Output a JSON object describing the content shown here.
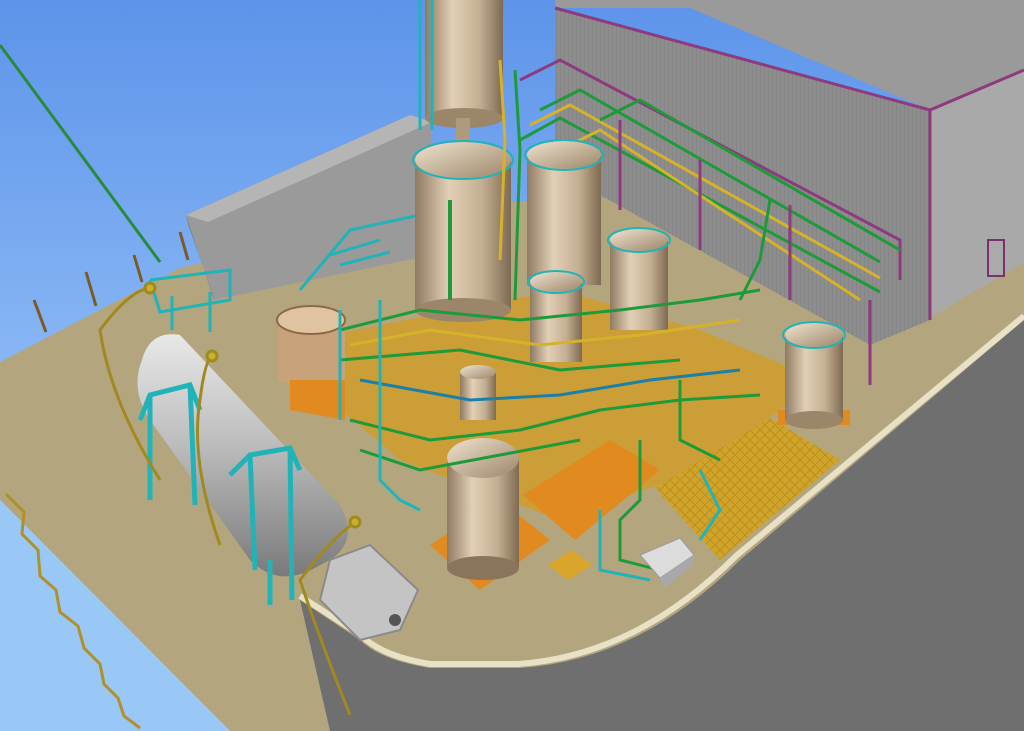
{
  "viewer": {
    "view": "3D plant model",
    "projection": "perspective",
    "render_style": "shaded"
  },
  "scene": {
    "sky_color_top": "#5d94ea",
    "sky_color_bottom": "#b5d9ff",
    "ground_color": "#b3a67e",
    "road_color": "#6f6f6f",
    "curb_color": "#e9e1c5"
  },
  "objects": {
    "vessel_color": "#c9b49a",
    "pipe_green": "#1e9a3a",
    "steel_cyan": "#22b3b8",
    "platform_orange": "#e08a20",
    "platform_yellow": "#d4a62a",
    "building_wall": "#8b8b8b",
    "building_roof": "#9a9a9a",
    "building_trim": "#8d3a7f",
    "tanker_body": "#b8b8b8"
  }
}
